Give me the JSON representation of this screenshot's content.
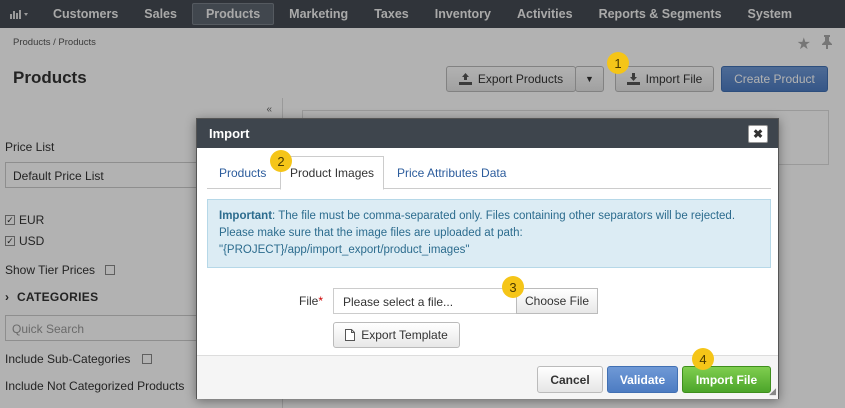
{
  "topnav": {
    "items": [
      "Customers",
      "Sales",
      "Products",
      "Marketing",
      "Taxes",
      "Inventory",
      "Activities",
      "Reports & Segments",
      "System"
    ]
  },
  "breadcrumb": "Products / Products",
  "page_title": "Products",
  "toolbar": {
    "export_products": "Export Products",
    "import_file": "Import File",
    "create_product": "Create Product"
  },
  "sidebar": {
    "price_list_label": "Price List",
    "price_list_value": "Default Price List",
    "currencies": [
      "EUR",
      "USD"
    ],
    "show_tier_prices": "Show Tier Prices",
    "categories": "CATEGORIES",
    "quick_search_placeholder": "Quick Search",
    "include_sub_categories": "Include Sub-Categories",
    "include_not_categorized": "Include Not Categorized Products"
  },
  "modal": {
    "title": "Import",
    "tabs": [
      "Products",
      "Product Images",
      "Price Attributes Data"
    ],
    "active_tab": "Product Images",
    "notice_bold": "Important",
    "notice_line1": ": The file must be comma-separated only. Files containing other separators will be rejected.",
    "notice_line2": "Please make sure that the image files are uploaded at path:",
    "notice_line3": "\"{PROJECT}/app/import_export/product_images\"",
    "file_label": "File",
    "file_required_mark": "*",
    "file_placeholder": "Please select a file...",
    "choose_file": "Choose File",
    "export_template": "Export Template",
    "cancel": "Cancel",
    "validate": "Validate",
    "import_file": "Import File"
  },
  "markers": [
    "1",
    "2",
    "3",
    "4"
  ],
  "colors": {
    "nav_bg": "#454b53",
    "primary": "#5a88ca",
    "success": "#5cb335",
    "marker": "#f5c518",
    "notice_bg": "#dcecf4"
  }
}
